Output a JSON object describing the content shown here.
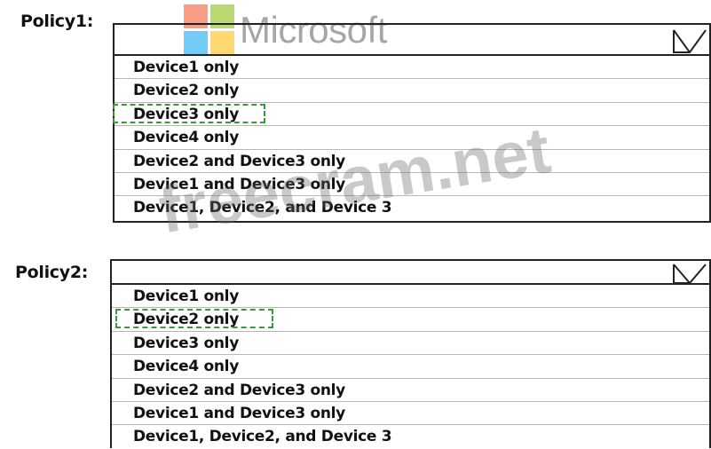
{
  "logo": {
    "text": "Microsoft",
    "colors": [
      "#f25022",
      "#7fba00",
      "#00a4ef",
      "#ffb900"
    ]
  },
  "watermark": "freecram.net",
  "policies": [
    {
      "label": "Policy1:",
      "options": [
        "Device1 only",
        "Device2 only",
        "Device3 only",
        "Device4 only",
        "Device2 and Device3 only",
        "Device1 and Device3 only",
        "Device1, Device2, and Device 3"
      ],
      "selected": "Device3 only"
    },
    {
      "label": "Policy2:",
      "options": [
        "Device1 only",
        "Device2 only",
        "Device3 only",
        "Device4 only",
        "Device2 and Device3 only",
        "Device1 and Device3 only",
        "Device1, Device2, and Device 3"
      ],
      "selected": "Device2 only"
    }
  ],
  "highlight_color": "#3a9a3a"
}
